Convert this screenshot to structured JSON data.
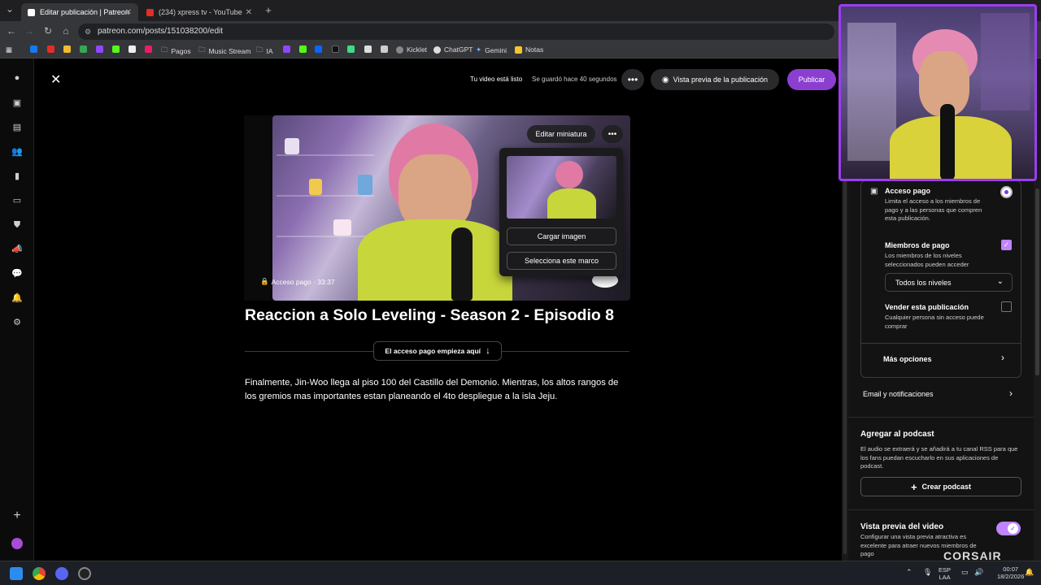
{
  "browser": {
    "tabs": [
      {
        "title": "Editar publicación | Patreon",
        "active": true
      },
      {
        "title": "(234) xpress tv - YouTube",
        "active": false
      }
    ],
    "url": "patreon.com/posts/151038200/edit",
    "bookmarks": [
      "Pagos",
      "Music Stream",
      "IA",
      "Kicklet",
      "ChatGPT",
      "Gemini",
      "Notas"
    ]
  },
  "editor": {
    "status_ready": "Tu video está listo",
    "status_saved": "Se guardó hace 40 segundos",
    "preview_button": "Vista previa de la publicación",
    "publish_button": "Publicar",
    "video": {
      "edit_thumbnail_button": "Editar miniatura",
      "access_badge": "Acceso pago · 33:37",
      "upload_image_button": "Cargar imagen",
      "select_frame_button": "Selecciona este marco"
    },
    "post_title": "Reaccion a Solo Leveling - Season 2 - Episodio 8",
    "paywall_divider": "El acceso pago empieza aquí",
    "body_text": "Finalmente, Jin-Woo llega al piso 100 del Castillo del Demonio. Mientras, los altos rangos de los gremios mas importantes estan planeando el 4to despliegue a la isla Jeju."
  },
  "sidebar": {
    "paid_access": {
      "title": "Acceso pago",
      "description": "Limita el acceso a los miembros de pago y a las personas que compren esta publicación.",
      "selected": true
    },
    "paid_members": {
      "title": "Miembros de pago",
      "description": "Los miembros de los niveles seleccionados pueden acceder",
      "checked": true
    },
    "tiers_dropdown": "Todos los niveles",
    "sell_post": {
      "title": "Vender esta publicación",
      "description": "Cualquier persona sin acceso puede comprar",
      "checked": false
    },
    "more_options": "Más opciones",
    "email_notifications": "Email y notificaciones",
    "podcast": {
      "title": "Agregar al podcast",
      "description": "El audio se extraerá y se añadirá a tu canal RSS para que los fans puedan escucharlo en sus aplicaciones de podcast.",
      "create_button": "Crear podcast"
    },
    "video_preview": {
      "title": "Vista previa del video",
      "description": "Configurar una vista previa atractiva es excelente para atraer nuevos miembros de pago",
      "enabled": true
    }
  },
  "overlay": {
    "brand_watermark": "CORSAIR"
  },
  "taskbar": {
    "language": "ESP\nLAA",
    "time": "00:07",
    "date": "18/2/2026"
  },
  "colors": {
    "accent": "#a855f7",
    "publish": "#8b3fd1",
    "cam_border": "#9b3df0"
  }
}
